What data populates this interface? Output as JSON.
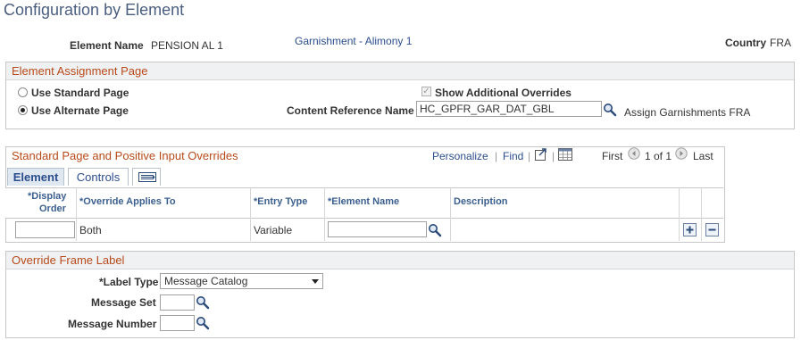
{
  "page": {
    "title": "Configuration by Element"
  },
  "header": {
    "element_name_label": "Element Name",
    "element_name_value": "PENSION AL 1",
    "element_desc_link": "Garnishment - Alimony 1",
    "country_label": "Country",
    "country_value": "FRA"
  },
  "assignment": {
    "title": "Element Assignment Page",
    "use_standard_label": "Use Standard Page",
    "use_alternate_label": "Use Alternate Page",
    "selected": "alternate",
    "show_overrides_label": "Show Additional Overrides",
    "show_overrides_checked": true,
    "content_ref_label": "Content Reference Name",
    "content_ref_value": "HC_GPFR_GAR_DAT_GBL",
    "content_ref_desc": "Assign Garnishments FRA"
  },
  "overrides": {
    "title": "Standard Page and Positive Input Overrides",
    "personalize": "Personalize",
    "sep": "|",
    "find": "Find",
    "first": "First",
    "pagination": "1 of 1",
    "last": "Last",
    "tabs": [
      {
        "label": "Element",
        "active": true
      },
      {
        "label": "Controls",
        "active": false
      }
    ],
    "columns": {
      "display_order_1": "*Display",
      "display_order_2": "Order",
      "override_applies": "*Override Applies To",
      "entry_type": "*Entry Type",
      "element_name": "*Element Name",
      "description": "Description"
    },
    "row": {
      "display_order": "",
      "override_applies": "Both",
      "entry_type": "Variable",
      "element_name": "",
      "description": ""
    }
  },
  "frame_label": {
    "title": "Override Frame Label",
    "label_type_label": "*Label Type",
    "label_type_value": "Message Catalog",
    "message_set_label": "Message Set",
    "message_set_value": "",
    "message_number_label": "Message Number",
    "message_number_value": ""
  },
  "colors": {
    "title": "#4a5e80",
    "section_title": "#b84a1a",
    "link": "#2b4d8c",
    "grid_header": "#3b5f8f",
    "group_head_bg": "#eff1f3"
  }
}
